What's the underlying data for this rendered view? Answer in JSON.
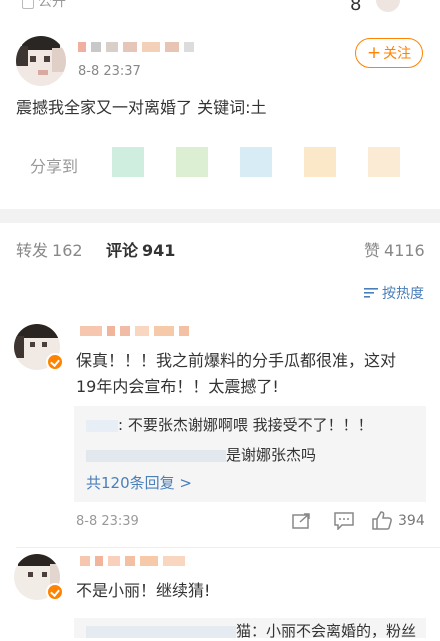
{
  "top": {
    "visibility_label": "公开"
  },
  "post": {
    "time": "8-8 23:37",
    "follow_label": "关注",
    "content": "震撼我全家又一对离婚了 关键词:土",
    "share_label": "分享到"
  },
  "tabs": [
    {
      "label": "转发",
      "count": "162"
    },
    {
      "label": "评论",
      "count": "941"
    },
    {
      "label": "赞",
      "count": "4116"
    }
  ],
  "sort_label": "按热度",
  "comments": [
    {
      "text": "保真！！！我之前爆料的分手瓜都很准，这对19年内会宣布！！太震撼了!",
      "replies": [
        {
          "text": ": 不要张杰谢娜啊喂 我接受不了！！！"
        },
        {
          "text": "是谢娜张杰吗"
        }
      ],
      "more_replies": "共120条回复 >",
      "time": "8-8 23:39",
      "likes": "394"
    },
    {
      "text": "不是小丽！继续猜!",
      "partial_reply": "猫：小丽不会离婚的，粉丝"
    }
  ],
  "colors": {
    "accent": "#ff8200",
    "link": "#4a7fba"
  }
}
